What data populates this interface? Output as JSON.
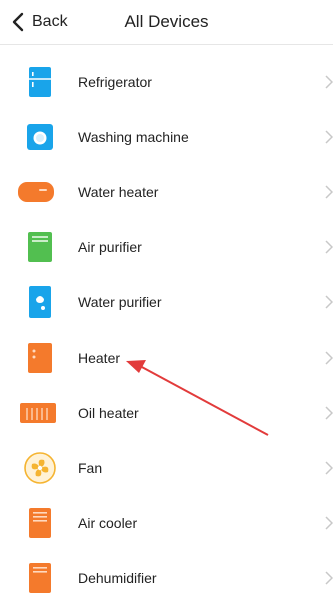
{
  "header": {
    "back_label": "Back",
    "title": "All Devices"
  },
  "devices": [
    {
      "label": "Refrigerator",
      "icon": "refrigerator-icon",
      "color": "#19a4ea"
    },
    {
      "label": "Washing machine",
      "icon": "washing-machine-icon",
      "color": "#19a4ea"
    },
    {
      "label": "Water heater",
      "icon": "water-heater-icon",
      "color": "#f47a2c"
    },
    {
      "label": "Air purifier",
      "icon": "air-purifier-icon",
      "color": "#52bf50"
    },
    {
      "label": "Water purifier",
      "icon": "water-purifier-icon",
      "color": "#19a4ea"
    },
    {
      "label": "Heater",
      "icon": "heater-icon",
      "color": "#f47a2c"
    },
    {
      "label": "Oil heater",
      "icon": "oil-heater-icon",
      "color": "#f47a2c"
    },
    {
      "label": "Fan",
      "icon": "fan-icon",
      "color": "#f5b431"
    },
    {
      "label": "Air cooler",
      "icon": "air-cooler-icon",
      "color": "#f47a2c"
    },
    {
      "label": "Dehumidifier",
      "icon": "dehumidifier-icon",
      "color": "#f47a2c"
    }
  ],
  "annotation": {
    "color": "#e23b3b"
  }
}
